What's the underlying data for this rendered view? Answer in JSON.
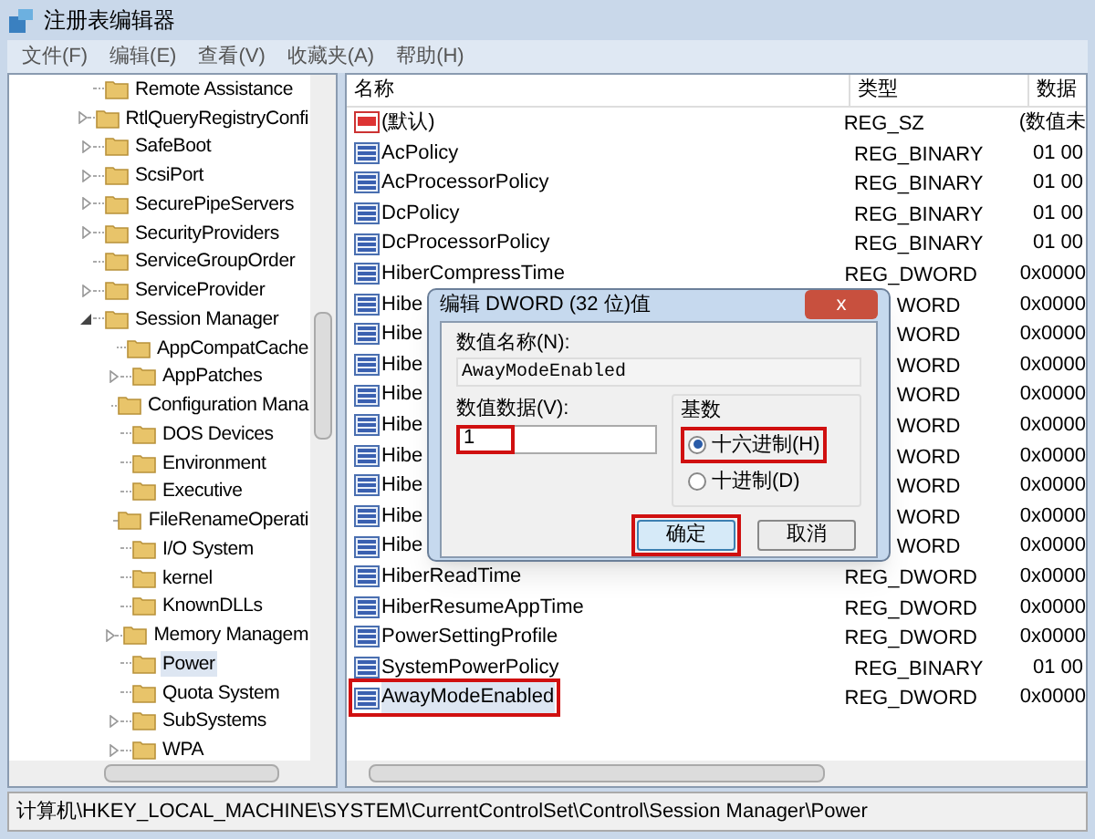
{
  "window": {
    "title": "注册表编辑器"
  },
  "menu": [
    "文件(F)",
    "编辑(E)",
    "查看(V)",
    "收藏夹(A)",
    "帮助(H)"
  ],
  "tree": [
    {
      "label": "Remote Assistance",
      "expandable": false,
      "expanded": false,
      "selected": false
    },
    {
      "label": "RtlQueryRegistryConfi",
      "expandable": true,
      "expanded": false,
      "selected": false
    },
    {
      "label": "SafeBoot",
      "expandable": true,
      "expanded": false,
      "selected": false
    },
    {
      "label": "ScsiPort",
      "expandable": true,
      "expanded": false,
      "selected": false
    },
    {
      "label": "SecurePipeServers",
      "expandable": true,
      "expanded": false,
      "selected": false
    },
    {
      "label": "SecurityProviders",
      "expandable": true,
      "expanded": false,
      "selected": false
    },
    {
      "label": "ServiceGroupOrder",
      "expandable": false,
      "expanded": false,
      "selected": false
    },
    {
      "label": "ServiceProvider",
      "expandable": true,
      "expanded": false,
      "selected": false
    },
    {
      "label": "Session Manager",
      "expandable": true,
      "expanded": true,
      "selected": false,
      "children": [
        {
          "label": "AppCompatCache",
          "expandable": false,
          "expanded": false,
          "selected": false
        },
        {
          "label": "AppPatches",
          "expandable": true,
          "expanded": false,
          "selected": false
        },
        {
          "label": "Configuration Mana",
          "expandable": false,
          "expanded": false,
          "selected": false
        },
        {
          "label": "DOS Devices",
          "expandable": false,
          "expanded": false,
          "selected": false
        },
        {
          "label": "Environment",
          "expandable": false,
          "expanded": false,
          "selected": false
        },
        {
          "label": "Executive",
          "expandable": false,
          "expanded": false,
          "selected": false
        },
        {
          "label": "FileRenameOperati",
          "expandable": false,
          "expanded": false,
          "selected": false
        },
        {
          "label": "I/O System",
          "expandable": false,
          "expanded": false,
          "selected": false
        },
        {
          "label": "kernel",
          "expandable": false,
          "expanded": false,
          "selected": false
        },
        {
          "label": "KnownDLLs",
          "expandable": false,
          "expanded": false,
          "selected": false
        },
        {
          "label": "Memory Managem",
          "expandable": true,
          "expanded": false,
          "selected": false
        },
        {
          "label": "Power",
          "expandable": false,
          "expanded": false,
          "selected": true
        },
        {
          "label": "Quota System",
          "expandable": false,
          "expanded": false,
          "selected": false
        },
        {
          "label": "SubSystems",
          "expandable": true,
          "expanded": false,
          "selected": false
        },
        {
          "label": "WPA",
          "expandable": true,
          "expanded": false,
          "selected": false
        }
      ]
    }
  ],
  "table": {
    "columns": [
      "名称",
      "类型",
      "数据"
    ],
    "rows": [
      {
        "kind": "string",
        "name": "(默认)",
        "type": "REG_SZ",
        "data": "(数值未",
        "highlighted": false
      },
      {
        "kind": "binary",
        "name": "AcPolicy",
        "type": "REG_BINARY",
        "data": "01 00",
        "highlighted": false
      },
      {
        "kind": "binary",
        "name": "AcProcessorPolicy",
        "type": "REG_BINARY",
        "data": "01 00",
        "highlighted": false
      },
      {
        "kind": "binary",
        "name": "DcPolicy",
        "type": "REG_BINARY",
        "data": "01 00",
        "highlighted": false
      },
      {
        "kind": "binary",
        "name": "DcProcessorPolicy",
        "type": "REG_BINARY",
        "data": "01 00",
        "highlighted": false
      },
      {
        "kind": "binary",
        "name": "HiberCompressTime",
        "type": "REG_DWORD",
        "data": "0x0000",
        "highlighted": false
      },
      {
        "kind": "covered",
        "name": "Hibe",
        "type": "WORD",
        "data": "0x0000",
        "highlighted": false
      },
      {
        "kind": "covered",
        "name": "Hibe",
        "type": "WORD",
        "data": "0x0000",
        "highlighted": false
      },
      {
        "kind": "covered",
        "name": "Hibe",
        "type": "WORD",
        "data": "0x0000",
        "highlighted": false
      },
      {
        "kind": "covered",
        "name": "Hibe",
        "type": "WORD",
        "data": "0x0000",
        "highlighted": false
      },
      {
        "kind": "covered",
        "name": "Hibe",
        "type": "WORD",
        "data": "0x0000",
        "highlighted": false
      },
      {
        "kind": "covered",
        "name": "Hibe",
        "type": "WORD",
        "data": "0x0000",
        "highlighted": false
      },
      {
        "kind": "covered",
        "name": "Hibe",
        "type": "WORD",
        "data": "0x0000",
        "highlighted": false
      },
      {
        "kind": "covered",
        "name": "Hibe",
        "type": "WORD",
        "data": "0x0000",
        "highlighted": false
      },
      {
        "kind": "covered",
        "name": "Hibe",
        "type": "WORD",
        "data": "0x0000",
        "highlighted": false
      },
      {
        "kind": "binary",
        "name": "HiberReadTime",
        "type": "REG_DWORD",
        "data": "0x0000",
        "highlighted": false
      },
      {
        "kind": "binary",
        "name": "HiberResumeAppTime",
        "type": "REG_DWORD",
        "data": "0x0000",
        "highlighted": false
      },
      {
        "kind": "binary",
        "name": "PowerSettingProfile",
        "type": "REG_DWORD",
        "data": "0x0000",
        "highlighted": false
      },
      {
        "kind": "binary",
        "name": "SystemPowerPolicy",
        "type": "REG_BINARY",
        "data": "01 00",
        "highlighted": false
      },
      {
        "kind": "binary",
        "name": "AwayModeEnabled",
        "type": "REG_DWORD",
        "data": "0x0000",
        "highlighted": true
      }
    ]
  },
  "dialog": {
    "title": "编辑 DWORD (32 位)值",
    "close": "x",
    "name_label": "数值名称(N):",
    "name_value": "AwayModeEnabled",
    "data_label": "数值数据(V):",
    "data_value": "1",
    "data_highlighted": true,
    "base_label": "基数",
    "radios": [
      {
        "label": "十六进制(H)",
        "selected": true,
        "highlighted": true
      },
      {
        "label": "十进制(D)",
        "selected": false,
        "highlighted": false
      }
    ],
    "buttons": [
      {
        "label": "确定",
        "default": true,
        "highlighted": true
      },
      {
        "label": "取消",
        "default": false,
        "highlighted": false
      }
    ]
  },
  "status_bar": "计算机\\HKEY_LOCAL_MACHINE\\SYSTEM\\CurrentControlSet\\Control\\Session Manager\\Power"
}
